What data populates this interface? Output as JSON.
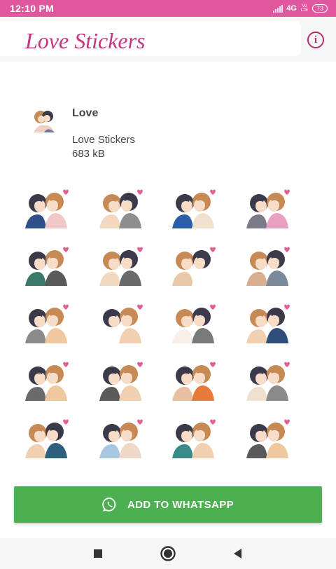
{
  "status_bar": {
    "time": "12:10 PM",
    "network": "4G",
    "volte": "Vo LTE",
    "battery": "73"
  },
  "app_bar": {
    "title": "Love Stickers",
    "info_icon": "info-icon"
  },
  "pack": {
    "name": "Love",
    "publisher": "Love Stickers",
    "size": "683 kB"
  },
  "stickers": [
    {
      "hair": "#3a3a4a",
      "hair2": "#c88a54",
      "shirt": "#2f4f8a",
      "shirt2": "#f0c8c8"
    },
    {
      "hair": "#c88a54",
      "hair2": "#3a3a4a",
      "shirt": "#f2d8c0",
      "shirt2": "#8e8e8e"
    },
    {
      "hair": "#3a3a4a",
      "hair2": "#c88a54",
      "shirt": "#2a5fa8",
      "shirt2": "#f0e0d0"
    },
    {
      "hair": "#3a3a4a",
      "hair2": "#c88a54",
      "shirt": "#7a7a8a",
      "shirt2": "#e8a0c0"
    },
    {
      "hair": "#3a3a4a",
      "hair2": "#c88a54",
      "shirt": "#3a7a6a",
      "shirt2": "#5a5a5a"
    },
    {
      "hair": "#c88a54",
      "hair2": "#3a3a4a",
      "shirt": "#f2d8c0",
      "shirt2": "#6a6a6a"
    },
    {
      "hair": "#c88a54",
      "hair2": "#3a3a4a",
      "shirt": "#e8c8a8",
      "shirt2": "#ffffff"
    },
    {
      "hair": "#c88a54",
      "hair2": "#3a3a4a",
      "shirt": "#d8b090",
      "shirt2": "#7a8a9a"
    },
    {
      "hair": "#3a3a4a",
      "hair2": "#c88a54",
      "shirt": "#8a8a8a",
      "shirt2": "#f0c8a0"
    },
    {
      "hair": "#3a3a4a",
      "hair2": "#c88a54",
      "shirt": "#ffffff",
      "shirt2": "#f0d0b0"
    },
    {
      "hair": "#c88a54",
      "hair2": "#3a3a4a",
      "shirt": "#f8f0e8",
      "shirt2": "#7a7a7a"
    },
    {
      "hair": "#c88a54",
      "hair2": "#3a3a4a",
      "shirt": "#f0d0b0",
      "shirt2": "#2f4f7a"
    },
    {
      "hair": "#3a3a4a",
      "hair2": "#c88a54",
      "shirt": "#6a6a6a",
      "shirt2": "#f0c8a0"
    },
    {
      "hair": "#3a3a4a",
      "hair2": "#c88a54",
      "shirt": "#5a5a5a",
      "shirt2": "#f0d0b0"
    },
    {
      "hair": "#3a3a4a",
      "hair2": "#c88a54",
      "shirt": "#e8c0a0",
      "shirt2": "#e87a3a"
    },
    {
      "hair": "#3a3a4a",
      "hair2": "#c88a54",
      "shirt": "#f0e0d0",
      "shirt2": "#8a8a8a"
    },
    {
      "hair": "#c88a54",
      "hair2": "#3a3a4a",
      "shirt": "#f0d0b0",
      "shirt2": "#2f5f7a"
    },
    {
      "hair": "#3a3a4a",
      "hair2": "#c88a54",
      "shirt": "#a8c8e0",
      "shirt2": "#f0d8c8"
    },
    {
      "hair": "#3a3a4a",
      "hair2": "#c88a54",
      "shirt": "#3a8a8a",
      "shirt2": "#f0d0b0"
    },
    {
      "hair": "#3a3a4a",
      "hair2": "#c88a54",
      "shirt": "#5a5a5a",
      "shirt2": "#f0c8a0"
    }
  ],
  "add_button": {
    "label": "ADD TO WHATSAPP",
    "icon": "whatsapp-icon"
  },
  "nav_bar": {
    "buttons": [
      "recents-square-icon",
      "home-circle-icon",
      "back-triangle-icon"
    ]
  },
  "colors": {
    "status_bar": "#e0579f",
    "title": "#c5357f",
    "button": "#4caf50"
  }
}
